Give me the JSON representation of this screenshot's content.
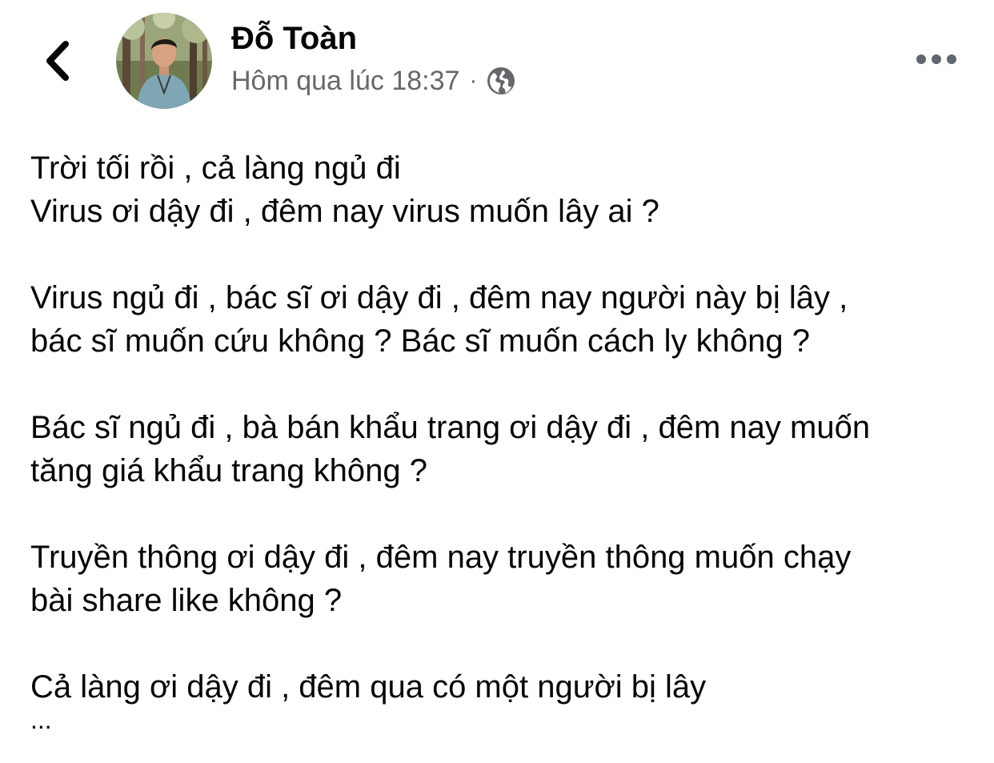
{
  "header": {
    "author_name": "Đỗ Toàn",
    "timestamp": "Hôm qua lúc 18:37",
    "separator": "·",
    "privacy_icon": "globe-icon",
    "back_icon": "chevron-left-icon",
    "more_icon": "more-horizontal-icon"
  },
  "post": {
    "paragraphs": [
      {
        "lines": [
          "Trời tối rồi , cả làng ngủ đi",
          "Virus ơi dậy đi , đêm nay virus muốn lây ai ?"
        ]
      },
      {
        "lines": [
          "Virus ngủ đi , bác sĩ ơi dậy đi , đêm nay người này bị lây ,",
          "bác sĩ muốn cứu không ? Bác sĩ muốn cách ly không ?"
        ]
      },
      {
        "lines": [
          "Bác sĩ ngủ đi , bà bán khẩu trang ơi dậy đi , đêm nay muốn",
          "tăng giá khẩu trang không ?"
        ]
      },
      {
        "lines": [
          "Truyền thông ơi dậy đi , đêm nay truyền thông muốn chạy",
          "bài share like không ?"
        ]
      },
      {
        "lines": [
          "Cả làng ơi dậy đi , đêm qua có một người bị lây"
        ]
      }
    ],
    "trailing": "..."
  },
  "colors": {
    "text": "#050505",
    "secondary_text": "#65676b",
    "icon": "#050505",
    "background": "#ffffff"
  }
}
